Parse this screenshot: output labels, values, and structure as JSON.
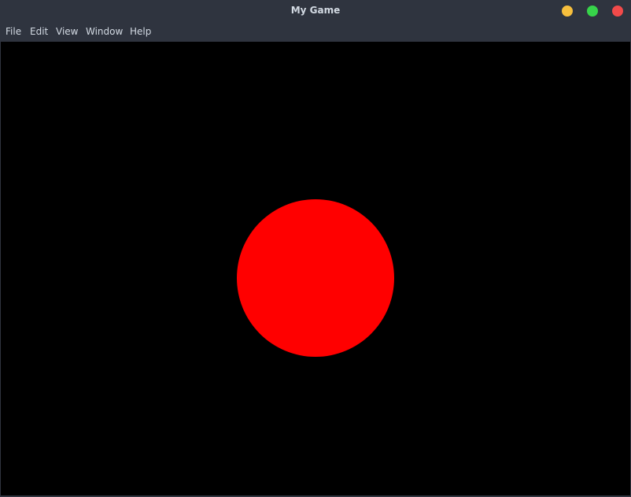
{
  "window": {
    "title": "My Game",
    "buttons": {
      "minimize_color": "#f7bf3d",
      "maximize_color": "#37d44a",
      "close_color": "#f24a4a"
    }
  },
  "menu": {
    "items": [
      "File",
      "Edit",
      "View",
      "Window",
      "Help"
    ]
  },
  "canvas": {
    "background_color": "#000000",
    "ball_color": "#ff0000"
  }
}
